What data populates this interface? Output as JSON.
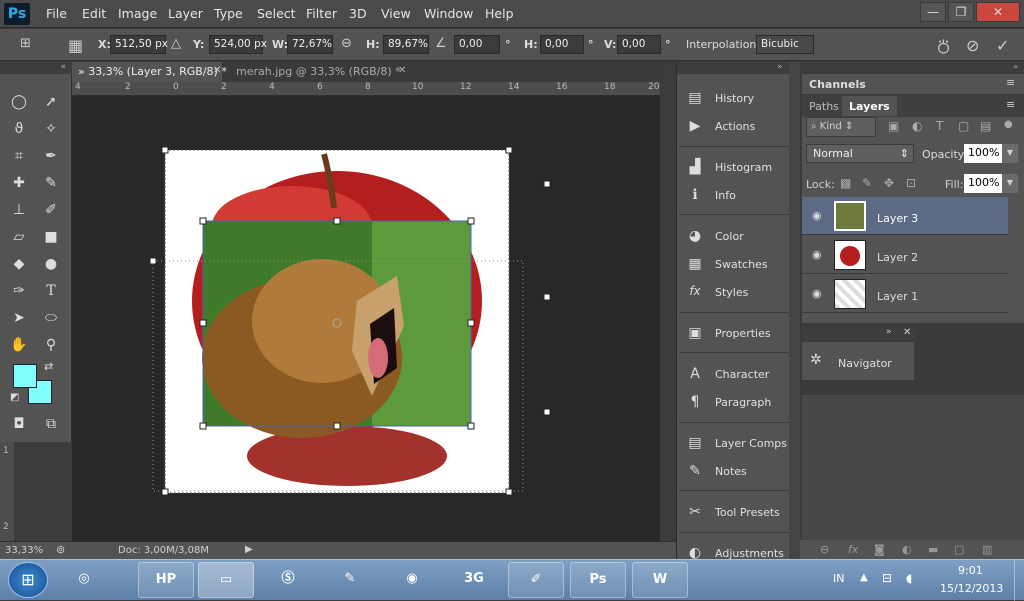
{
  "menubar": {
    "logo": "Ps",
    "items": [
      "File",
      "Edit",
      "Image",
      "Layer",
      "Type",
      "Select",
      "Filter",
      "3D",
      "View",
      "Window",
      "Help"
    ]
  },
  "window_controls": {
    "minimize": "—",
    "restore": "❐",
    "close": "✕"
  },
  "options": {
    "x_label": "X:",
    "x_value": "512,50 px",
    "y_label": "Y:",
    "y_value": "524,00 px",
    "w_label": "W:",
    "w_value": "72,67%",
    "h_label": "H:",
    "h_value": "89,67%",
    "angle_value": "0,00",
    "angle_unit": "°",
    "hskew_label": "H:",
    "hskew_value": "0,00",
    "hskew_unit": "°",
    "vskew_label": "V:",
    "vskew_value": "0,00",
    "vskew_unit": "°",
    "interp_label": "Interpolation:",
    "interp_value": "Bicubic"
  },
  "tabs": [
    {
      "label": "» 33,3% (Layer 3, RGB/8) *",
      "active": true
    },
    {
      "label": "merah.jpg @ 33,3% (RGB/8) *",
      "active": false
    }
  ],
  "ruler_top": [
    "4",
    "2",
    "0",
    "2",
    "4",
    "6",
    "8",
    "10",
    "12",
    "14",
    "16",
    "18",
    "20"
  ],
  "ruler_left": [
    "1",
    "2"
  ],
  "status": {
    "zoom": "33,33%",
    "doc": "Doc: 3,00M/3,08M"
  },
  "dock": [
    {
      "label": "History",
      "icon": "history-icon",
      "glyph": "▤"
    },
    {
      "label": "Actions",
      "icon": "actions-icon",
      "glyph": "▶"
    },
    {
      "label": "Histogram",
      "icon": "histogram-icon",
      "glyph": "▟"
    },
    {
      "label": "Info",
      "icon": "info-icon",
      "glyph": "ℹ"
    },
    {
      "label": "Color",
      "icon": "color-icon",
      "glyph": "◕"
    },
    {
      "label": "Swatches",
      "icon": "swatches-icon",
      "glyph": "▦"
    },
    {
      "label": "Styles",
      "icon": "styles-icon",
      "glyph": "fx"
    },
    {
      "label": "Properties",
      "icon": "properties-icon",
      "glyph": "▣"
    },
    {
      "label": "Character",
      "icon": "character-icon",
      "glyph": "A"
    },
    {
      "label": "Paragraph",
      "icon": "paragraph-icon",
      "glyph": "¶"
    },
    {
      "label": "Layer Comps",
      "icon": "layer-comps-icon",
      "glyph": "▤"
    },
    {
      "label": "Notes",
      "icon": "notes-icon",
      "glyph": "✎"
    },
    {
      "label": "Tool Presets",
      "icon": "tool-presets-icon",
      "glyph": "✂"
    },
    {
      "label": "Adjustments",
      "icon": "adjustments-icon",
      "glyph": "◐"
    }
  ],
  "panels": {
    "channels": "Channels",
    "paths": "Paths",
    "layers": "Layers",
    "kind": "Kind",
    "blend_mode": "Normal",
    "opacity_label": "Opacity:",
    "opacity_value": "100%",
    "lock_label": "Lock:",
    "fill_label": "Fill:",
    "fill_value": "100%",
    "navigator": "Navigator"
  },
  "layers": [
    {
      "name": "Layer 3",
      "selected": true
    },
    {
      "name": "Layer 2",
      "selected": false
    },
    {
      "name": "Layer 1",
      "selected": false
    }
  ],
  "taskbar": {
    "tray_lang": "IN",
    "time": "9:01",
    "date": "15/12/2013",
    "apps": [
      "HP",
      "Files",
      "Skype",
      "Edit",
      "Firefox",
      "3G",
      "Paint",
      "Ps",
      "W"
    ]
  },
  "colors": {
    "foreground": "#80ffff",
    "background": "#80ffff",
    "selected_layer": "#5c6a86"
  }
}
